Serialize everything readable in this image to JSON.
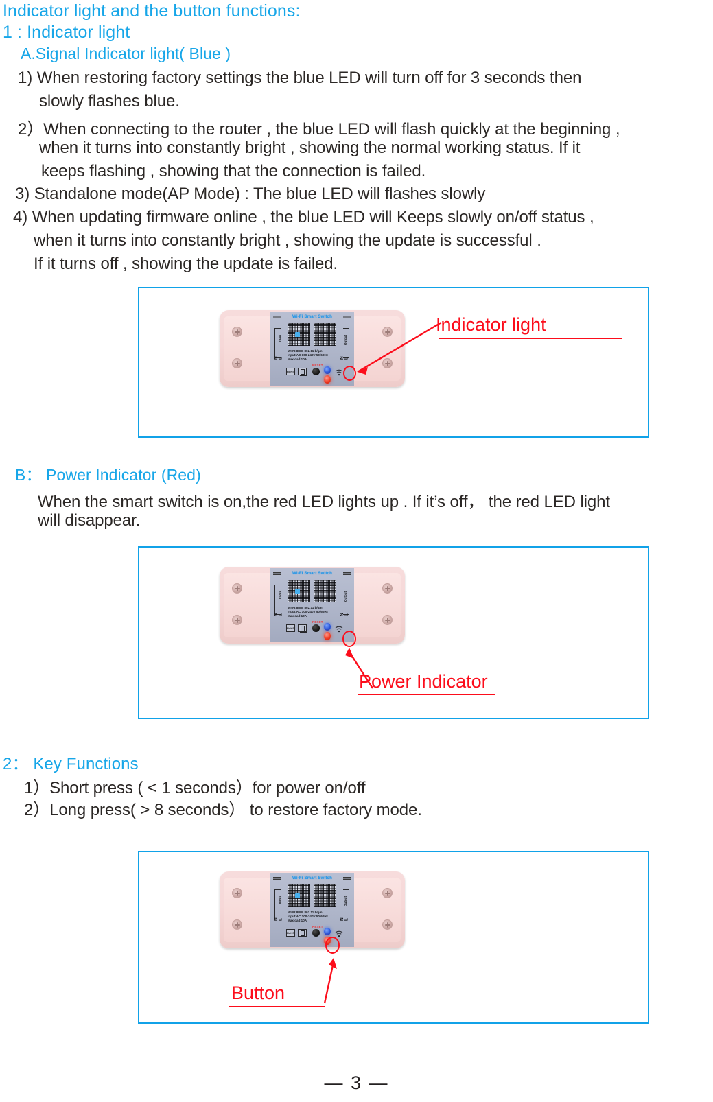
{
  "page": {
    "number_label": "— 3 —",
    "heading_color": "#17a6e8",
    "body_color": "#2b2725",
    "callout_color": "#fc0d1b",
    "box_border_color": "#11a2e8"
  },
  "headings": {
    "main": "Indicator  light and the button functions:",
    "section1": "1 : Indicator  light",
    "sectionA": "A.Signal Indicator  light( Blue )",
    "sectionB": "B：   Power Indicator (Red)",
    "section2": "2：  Key Functions"
  },
  "paragraph_a": [
    "1) When restoring factory settings the blue LED will turn off for 3 seconds then",
    "slowly flashes blue.",
    "2）When connecting to the router , the blue LED will flash quickly at the beginning ,",
    "when it turns into constantly bright , showing the normal working status. If it",
    "keeps flashing  , showing that the connection is failed.",
    "3) Standalone mode(AP Mode) : The blue LED will flashes slowly",
    "4) When updating firmware online , the blue LED will Keeps slowly on/off status ,",
    "when it turns into constantly bright , showing the update is successful .",
    "If it turns off , showing the update is failed."
  ],
  "paragraph_b": [
    "When the smart switch is on,the red LED lights up . If  it’s off，  the red LED light",
    "will disappear."
  ],
  "paragraph_2": [
    "1）Short press ( < 1 seconds）for power on/off",
    "2）Long press( > 8 seconds）  to restore factory mode."
  ],
  "figures": [
    {
      "id": "fig-indicator-light",
      "callout": "Indicator light"
    },
    {
      "id": "fig-power-indicator",
      "callout": "Power Indicator"
    },
    {
      "id": "fig-button",
      "callout": "Button"
    }
  ],
  "device": {
    "title": "Wi-Fi Smart Switch",
    "spec_lines": [
      "WI-FI:IEEE 802.11 b/g/n",
      "Input:AC 100-240V 50/60Hz",
      "Maxload 10A"
    ],
    "reset_label": "RESET",
    "terminal_left_nl": "N L",
    "terminal_left_word": "Input",
    "terminal_right_nl": "N L",
    "terminal_right_word": "Output",
    "cert_rohs": "RoHS",
    "body_color": "#f6d8d8",
    "plate_color": "#aeb5c9",
    "title_color": "#2196e8",
    "led_blue_color": "#2a55d8",
    "led_red_color": "#f03a22"
  }
}
